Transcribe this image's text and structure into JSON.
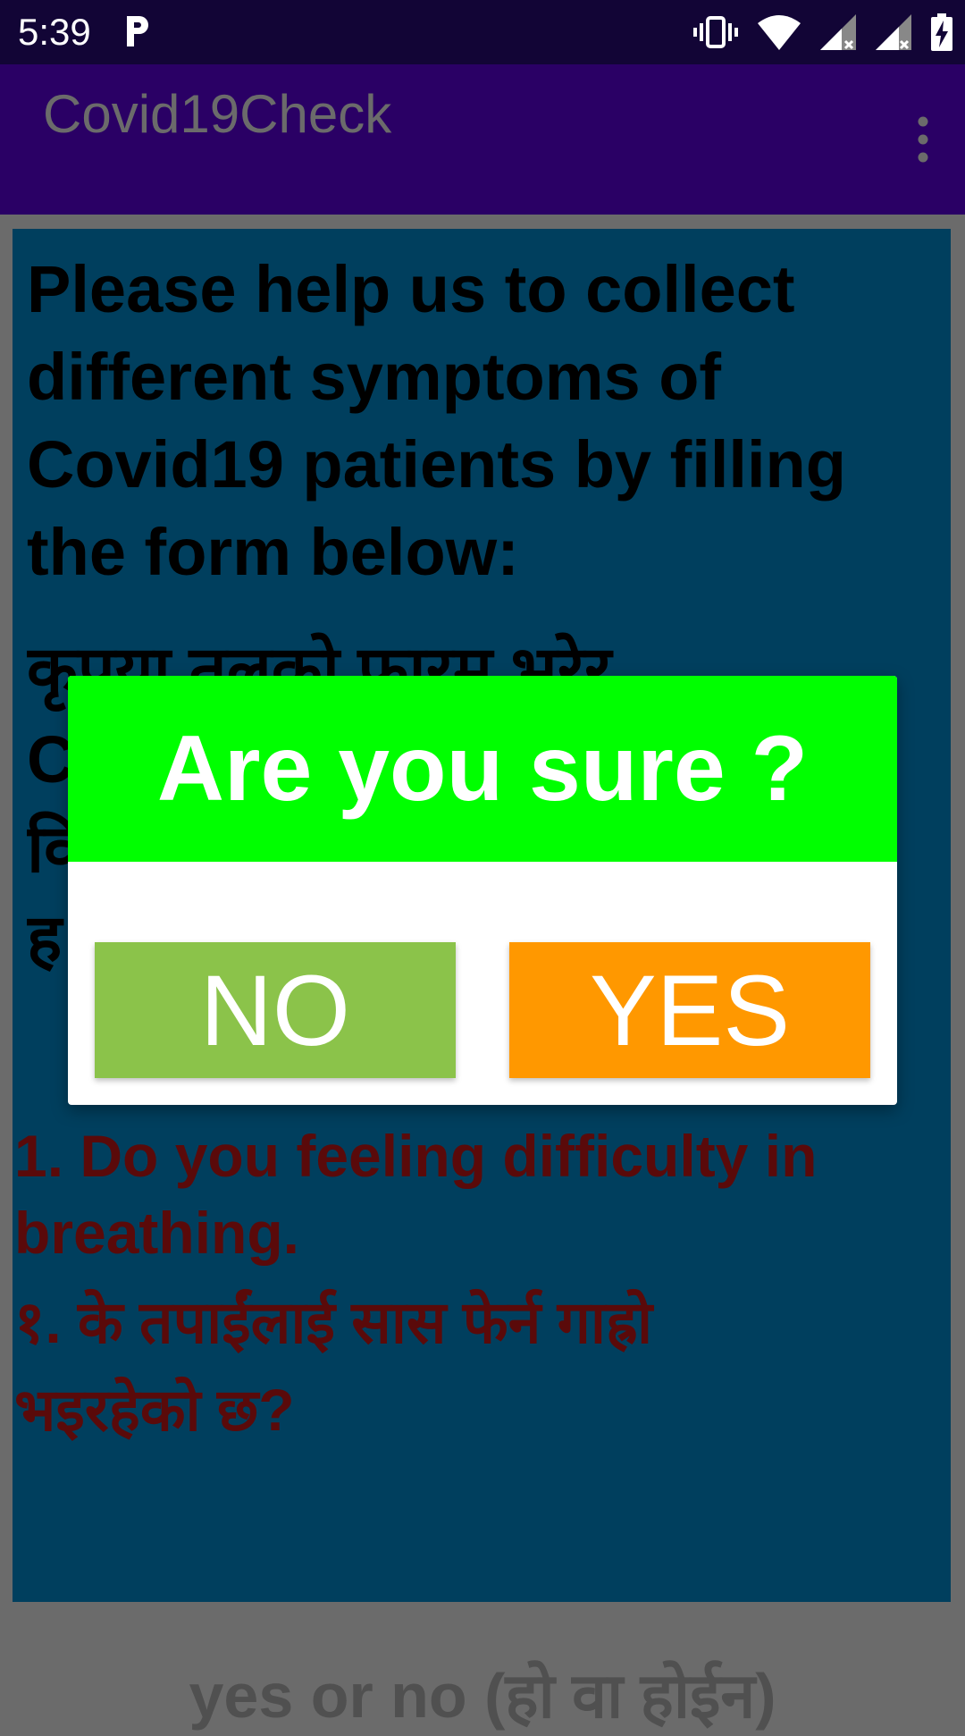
{
  "status_bar": {
    "time": "5:39",
    "icons": [
      "parking-icon",
      "vibrate-icon",
      "wifi-icon",
      "signal-icon",
      "signal-icon",
      "battery-charging-icon"
    ]
  },
  "app_bar": {
    "title": "Covid19Check",
    "menu_icon": "overflow-menu-icon"
  },
  "content": {
    "intro_en": "Please help us to collect\ndifferent symptoms of\nCovid19 patients by filling\nthe form below:",
    "intro_np": "कृपया तलको फारम भरेर\nC\nवि\nह",
    "question_en": "1. Do you feeling difficulty in\nbreathing.",
    "question_np": "१. के तपाईंलाई सास फेर्न गाह्रो\nभइरहेको छ?",
    "answer_hint": "yes or no (हो वा होईन)"
  },
  "dialog": {
    "title": "Are you sure ?",
    "no_label": "NO",
    "yes_label": "YES"
  },
  "colors": {
    "status_bar": "#120536",
    "app_bar": "#2a0065",
    "panel": "#003f5e",
    "dialog_header": "#00ff00",
    "no_button": "#8bc34a",
    "yes_button": "#ff9800",
    "question_text": "#5a0a0a"
  }
}
